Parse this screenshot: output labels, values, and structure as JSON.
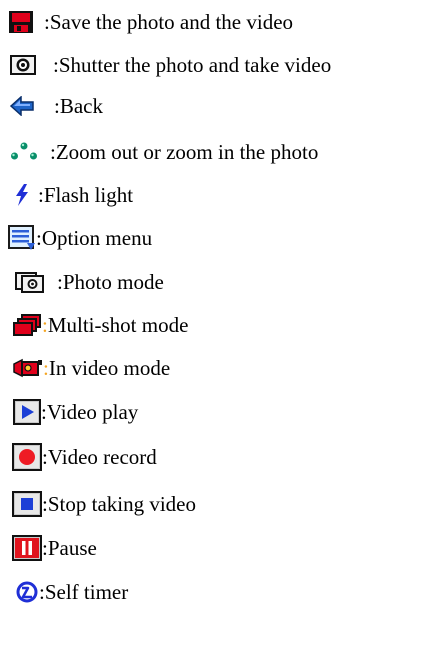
{
  "items": [
    {
      "icon": "save-icon",
      "separator": ": ",
      "text": "Save the photo and the video"
    },
    {
      "icon": "shutter-icon",
      "separator": ": ",
      "text": "Shutter the photo and take video"
    },
    {
      "icon": "back-arrow-icon",
      "separator": ": ",
      "text": "Back"
    },
    {
      "icon": "zoom-icon",
      "separator": ": ",
      "text": "Zoom out or zoom in the photo"
    },
    {
      "icon": "flash-icon",
      "separator": ": ",
      "text": "Flash light"
    },
    {
      "icon": "option-menu-icon",
      "separator": ":",
      "text": " Option menu"
    },
    {
      "icon": "photo-mode-icon",
      "separator": ": ",
      "text": "Photo mode"
    },
    {
      "icon": "multi-shot-icon",
      "separator": ":",
      "text": " Multi-shot mode"
    },
    {
      "icon": "video-mode-icon",
      "separator": ":",
      "text": " In video mode"
    },
    {
      "icon": "video-play-icon",
      "separator": ":",
      "text": " Video play"
    },
    {
      "icon": "video-record-icon",
      "separator": ":",
      "text": " Video record"
    },
    {
      "icon": "stop-video-icon",
      "separator": ":",
      "text": " Stop taking video"
    },
    {
      "icon": "pause-icon",
      "separator": ":",
      "text": " Pause"
    },
    {
      "icon": "self-timer-icon",
      "separator": ":",
      "text": " Self timer"
    }
  ],
  "colors": {
    "save_red": "#e0001b",
    "back_blue": "#1e64c8",
    "zoom_green": "#0a8f6a",
    "flash_blue": "#1f2fd6",
    "menu_blue": "#2c5fd8",
    "play_blue": "#1c3fd6",
    "record_red": "#ee1b24",
    "pause_red": "#e0141e",
    "separator_orange": "#f5a623"
  }
}
